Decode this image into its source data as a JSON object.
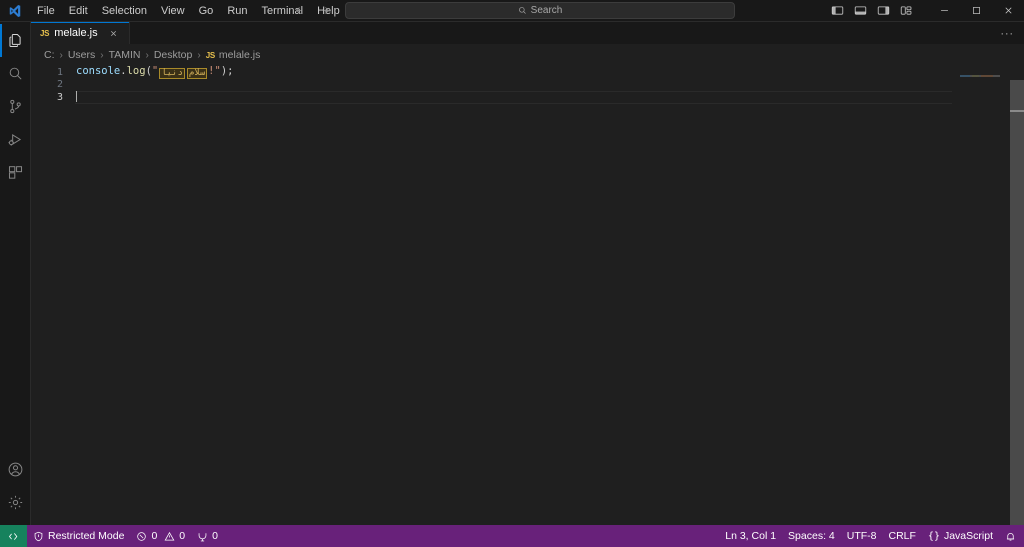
{
  "window": {
    "logo_icon": "vscode-logo-icon",
    "menu": [
      {
        "label": "File"
      },
      {
        "label": "Edit"
      },
      {
        "label": "Selection"
      },
      {
        "label": "View"
      },
      {
        "label": "Go"
      },
      {
        "label": "Run"
      },
      {
        "label": "Terminal"
      },
      {
        "label": "Help"
      }
    ],
    "nav": {
      "back_icon": "arrow-left-icon",
      "forward_icon": "arrow-right-icon"
    },
    "search": {
      "icon": "search-icon",
      "placeholder": "Search",
      "value": "Search"
    },
    "layout_buttons": [
      {
        "name": "toggle-primary-sidebar-button",
        "icon": "panel-left-icon"
      },
      {
        "name": "toggle-panel-button",
        "icon": "panel-bottom-icon"
      },
      {
        "name": "toggle-secondary-sidebar-button",
        "icon": "panel-right-icon"
      },
      {
        "name": "customize-layout-button",
        "icon": "layout-grid-icon"
      }
    ],
    "controls": {
      "minimize": "minimize-icon",
      "maximize": "maximize-icon",
      "close": "close-icon"
    }
  },
  "activitybar": {
    "top_items": [
      {
        "name": "sidebar-item-explorer",
        "icon": "files-icon",
        "active": true
      },
      {
        "name": "sidebar-item-search",
        "icon": "search-icon",
        "active": false
      },
      {
        "name": "sidebar-item-source-control",
        "icon": "source-control-icon",
        "active": false
      },
      {
        "name": "sidebar-item-run-and-debug",
        "icon": "run-debug-icon",
        "active": false
      },
      {
        "name": "sidebar-item-extensions",
        "icon": "extensions-icon",
        "active": false
      }
    ],
    "bottom_items": [
      {
        "name": "accounts-button",
        "icon": "account-icon"
      },
      {
        "name": "manage-settings-button",
        "icon": "gear-icon"
      }
    ]
  },
  "tabs": [
    {
      "label": "melale.js",
      "badge": "JS",
      "close_icon": "close-icon",
      "active": true
    }
  ],
  "editor_actions": {
    "more_label": "···"
  },
  "breadcrumb": {
    "separator": "›",
    "items": [
      {
        "label": "C:"
      },
      {
        "label": "Users"
      },
      {
        "label": "TAMIN"
      },
      {
        "label": "Desktop"
      },
      {
        "label": "melale.js",
        "badge": "JS"
      }
    ]
  },
  "code": {
    "lines": [
      {
        "number": "1",
        "active": false,
        "tokens": [
          {
            "type": "var",
            "text": "console"
          },
          {
            "type": "punct",
            "text": "."
          },
          {
            "type": "fn",
            "text": "log"
          },
          {
            "type": "punct",
            "text": "("
          },
          {
            "type": "str",
            "text": "\""
          },
          {
            "type": "bidi",
            "text": "دنيا"
          },
          {
            "type": "bidi",
            "text": "سلام"
          },
          {
            "type": "str",
            "text": "!\""
          },
          {
            "type": "punct",
            "text": ");"
          }
        ]
      },
      {
        "number": "2",
        "active": false,
        "tokens": []
      },
      {
        "number": "3",
        "active": true,
        "tokens": [],
        "cursor": true
      }
    ]
  },
  "minimap": {
    "name": "minimap"
  },
  "statusbar": {
    "remote": {
      "icon": "remote-indicator-icon",
      "label": ""
    },
    "left_items": [
      {
        "name": "status-restricted-mode",
        "icon": "shield-icon",
        "label": "Restricted Mode"
      },
      {
        "name": "status-problems",
        "icon": "error-icon",
        "label": "0",
        "icon2": "warning-icon",
        "label2": "0"
      },
      {
        "name": "status-ports",
        "icon": "ports-icon",
        "label": "0"
      }
    ],
    "right_items": [
      {
        "name": "status-cursor-position",
        "label": "Ln 3, Col 1"
      },
      {
        "name": "status-indentation",
        "label": "Spaces: 4"
      },
      {
        "name": "status-encoding",
        "label": "UTF-8"
      },
      {
        "name": "status-eol",
        "label": "CRLF"
      },
      {
        "name": "status-language-mode",
        "label": "JavaScript",
        "icon": "braces-icon"
      },
      {
        "name": "status-notifications",
        "icon": "bell-icon",
        "label": ""
      }
    ]
  },
  "colors": {
    "accent": "#0078d4",
    "statusbar_bg": "#68217a",
    "remote_bg": "#16825d",
    "editor_bg": "#1f1f1f",
    "chrome_bg": "#181818",
    "token_variable": "#9cdcfe",
    "token_function": "#dcdcaa",
    "token_string": "#ce9178",
    "bidi_highlight_border": "#a88a2a"
  }
}
